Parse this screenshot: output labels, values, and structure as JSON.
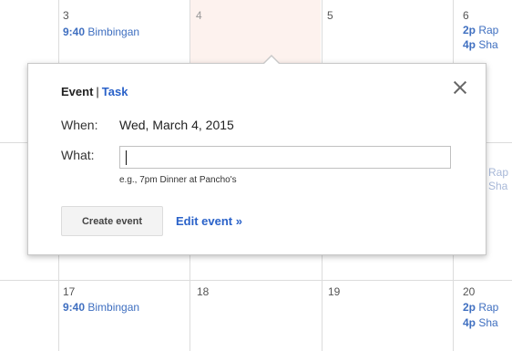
{
  "calendar": {
    "top_row": [
      {
        "day": "3",
        "events": [
          {
            "time": "9:40",
            "title": "Bimbingan"
          }
        ]
      },
      {
        "day": "4",
        "events": []
      },
      {
        "day": "5",
        "events": []
      },
      {
        "day": "6",
        "events": [
          {
            "time": "2p",
            "title": "Rap"
          },
          {
            "time": "4p",
            "title": "Sha"
          }
        ]
      }
    ],
    "middle_row_partial": [
      {
        "text": "Rap"
      },
      {
        "text": "Sha"
      }
    ],
    "bottom_row": [
      {
        "day": "17",
        "events": [
          {
            "time": "9:40",
            "title": "Bimbingan"
          }
        ]
      },
      {
        "day": "18",
        "events": []
      },
      {
        "day": "19",
        "events": []
      },
      {
        "day": "20",
        "events": [
          {
            "time": "2p",
            "title": "Rap"
          },
          {
            "time": "4p",
            "title": "Sha"
          }
        ]
      }
    ],
    "today_color": "#fdf2ee",
    "event_color": "#3f6fc0"
  },
  "popup": {
    "tabs": {
      "event": "Event",
      "separator": "|",
      "task": "Task"
    },
    "when_label": "When:",
    "when_value": "Wed, March 4, 2015",
    "what_label": "What:",
    "what_value": "",
    "hint": "e.g., 7pm Dinner at Pancho's",
    "create_button": "Create event",
    "edit_link": "Edit event »",
    "accent_color": "#2a62c9"
  }
}
